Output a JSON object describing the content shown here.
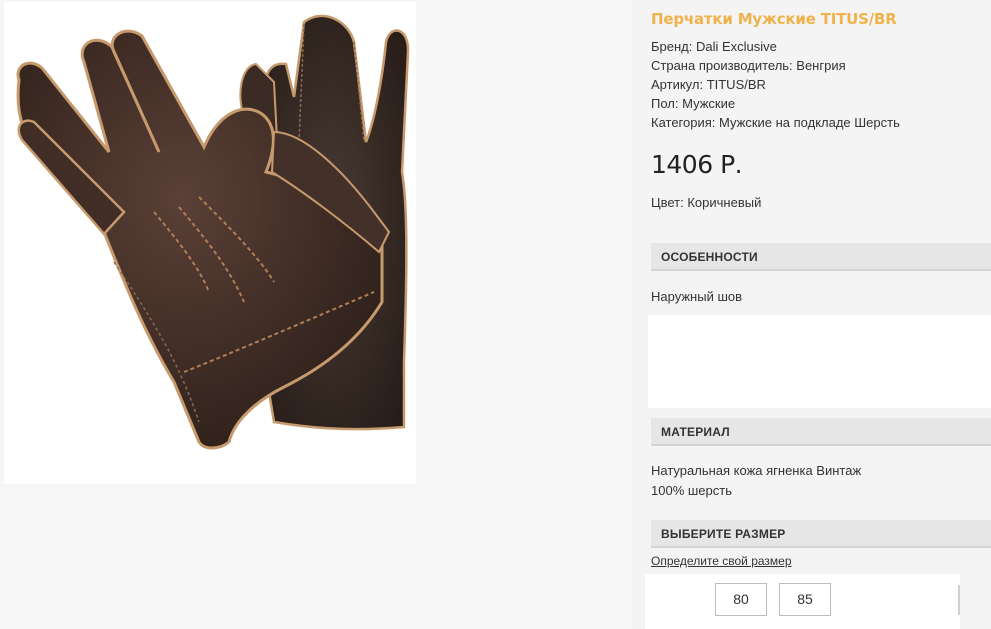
{
  "product": {
    "title": "Перчатки Мужские TITUS/BR",
    "image_alt": "gloves-photo",
    "props": [
      "Бренд: Dali Exclusive",
      "Страна производитель: Венгрия",
      "Артикул: TITUS/BR",
      "Пол: Мужские",
      "Категория: Мужские на подкладе Шерсть"
    ],
    "price": "1406 Р.",
    "color": "Цвет: Коричневый"
  },
  "sections": {
    "features": {
      "heading": "ОСОБЕННОСТИ",
      "text": "Наружный шов"
    },
    "material": {
      "heading": "МАТЕРИАЛ",
      "line1": "Натуральная кожа ягненка Винтаж",
      "line2": "100% шерсть"
    },
    "size": {
      "heading": "ВЫБЕРИТЕ РАЗМЕР",
      "link": "Определите свой размер",
      "options": [
        "80",
        "85"
      ]
    }
  },
  "colors": {
    "title": "#f0b24a",
    "leather": "#3a2a22",
    "stitch": "#c79a6e"
  }
}
